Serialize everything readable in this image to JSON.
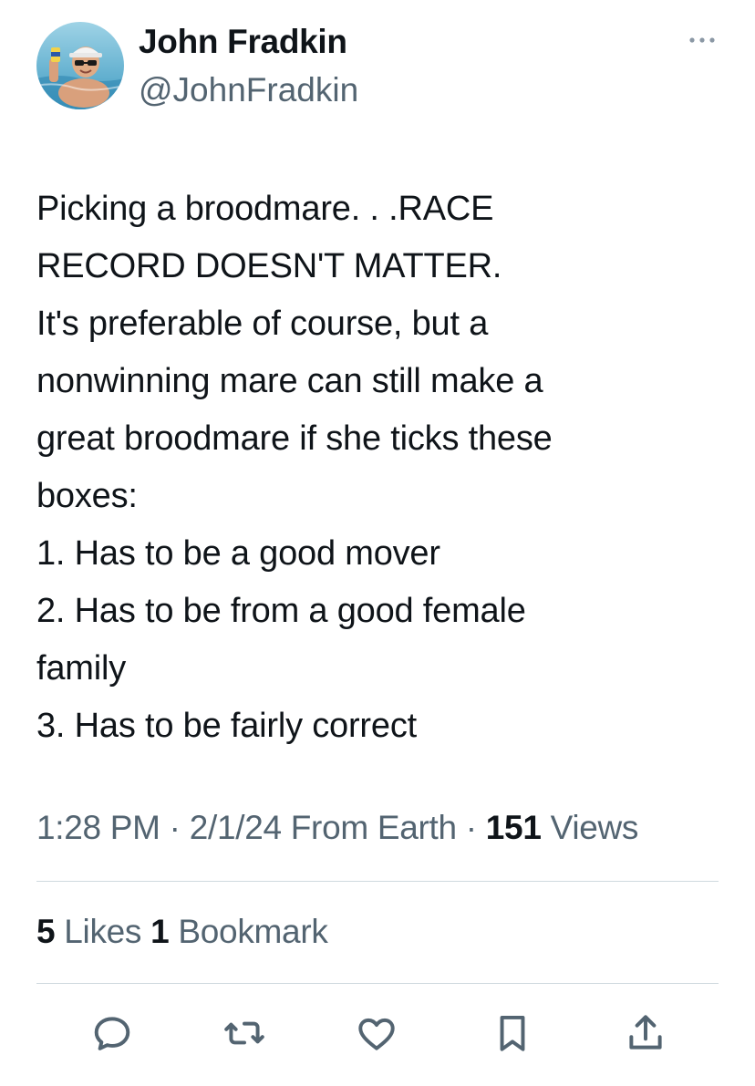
{
  "author": {
    "display_name": "John Fradkin",
    "handle": "@JohnFradkin",
    "avatar_icon": "profile-photo-in-pool"
  },
  "more_icon": "more-horizontal-icon",
  "tweet": {
    "lines": [
      "Picking a broodmare. . .RACE",
      "RECORD DOESN'T MATTER.",
      "It's preferable of course, but a",
      "nonwinning mare can still make a",
      "great broodmare if she ticks these",
      "boxes:",
      "1.  Has to be a good mover",
      "2.  Has to be from a good female",
      "family",
      "3.  Has to be fairly correct"
    ]
  },
  "meta": {
    "time": "1:28 PM",
    "separator1": " · ",
    "date": "2/1/24",
    "source": " From Earth",
    "separator2": " · ",
    "views_count": "151",
    "views_label": " Views"
  },
  "stats": {
    "likes_count": "5",
    "likes_label": " Likes ",
    "bookmarks_count": "1",
    "bookmarks_label": " Bookmark"
  },
  "actions": [
    {
      "icon": "reply-icon"
    },
    {
      "icon": "retweet-icon"
    },
    {
      "icon": "like-icon"
    },
    {
      "icon": "bookmark-icon"
    },
    {
      "icon": "share-icon"
    }
  ],
  "colors": {
    "text_primary": "#0f1419",
    "text_secondary": "#536471",
    "divider": "#cfd9de",
    "icon": "#536471"
  }
}
